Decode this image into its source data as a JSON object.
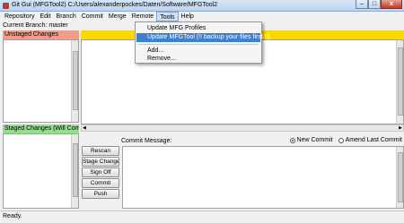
{
  "window": {
    "title": "Git Gui (MFGTool2) C:/Users/alexanderpockes/Daten/Software/MFGTool2",
    "minimize": "–",
    "maximize": "□",
    "close": "x"
  },
  "menubar": {
    "items": [
      "Repository",
      "Edit",
      "Branch",
      "Commit",
      "Merge",
      "Remote",
      "Tools",
      "Help"
    ],
    "active": "Tools"
  },
  "tools_menu": {
    "items": [
      "Update MFG Profiles",
      "Update MFGTool (!! backup your files first !!)",
      "Add...",
      "Remove..."
    ],
    "highlighted_index": 1
  },
  "left_pane": {
    "current_branch": "Current Branch: master",
    "unstaged_header": "Unstaged Changes",
    "staged_header": "Staged Changes (Will Commit)"
  },
  "commit": {
    "message_label": "Commit Message:",
    "radio_new": "New Commit",
    "radio_amend": "Amend Last Commit",
    "selected": "new",
    "buttons": {
      "rescan": "Rescan",
      "stage_changed": "Stage Changed",
      "sign_off": "Sign Off",
      "commit": "Commit",
      "push": "Push"
    }
  },
  "status": {
    "text": "Ready."
  },
  "colors": {
    "unstaged": "#f49a8a",
    "staged": "#8ee08a",
    "diff_header": "#ffd700",
    "menu_highlight": "#3c7fd3"
  }
}
